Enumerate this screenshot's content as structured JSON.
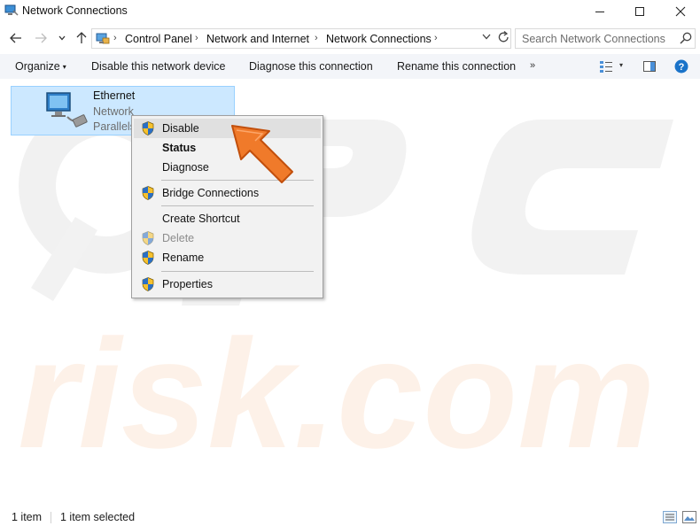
{
  "window": {
    "title": "Network Connections",
    "minimize_icon": "minimize-icon",
    "maximize_icon": "maximize-icon",
    "close_icon": "close-icon"
  },
  "address": {
    "breadcrumbs": [
      "Control Panel",
      "Network and Internet",
      "Network Connections"
    ],
    "search_placeholder": "Search Network Connections"
  },
  "commands": {
    "organize": "Organize",
    "disable": "Disable this network device",
    "diagnose": "Diagnose this connection",
    "rename": "Rename this connection",
    "more": "»"
  },
  "item": {
    "name": "Ethernet",
    "status": "Network",
    "device": "Parallels"
  },
  "context_menu": {
    "items": [
      {
        "label": "Disable",
        "shield": true,
        "bold": false,
        "disabled": false,
        "highlighted": true
      },
      {
        "label": "Status",
        "shield": false,
        "bold": true,
        "disabled": false,
        "highlighted": false
      },
      {
        "label": "Diagnose",
        "shield": false,
        "bold": false,
        "disabled": false,
        "highlighted": false
      },
      {
        "label": "Bridge Connections",
        "shield": true,
        "bold": false,
        "disabled": false,
        "highlighted": false
      },
      {
        "label": "Create Shortcut",
        "shield": false,
        "bold": false,
        "disabled": false,
        "highlighted": false
      },
      {
        "label": "Delete",
        "shield": true,
        "bold": false,
        "disabled": true,
        "highlighted": false
      },
      {
        "label": "Rename",
        "shield": true,
        "bold": false,
        "disabled": false,
        "highlighted": false
      },
      {
        "label": "Properties",
        "shield": true,
        "bold": false,
        "disabled": false,
        "highlighted": false
      }
    ]
  },
  "status": {
    "count": "1 item",
    "selected": "1 item selected"
  },
  "colors": {
    "selection_bg": "#cce8ff",
    "selection_border": "#99d1ff",
    "arrow": "#f07a2a",
    "help": "#1a73c9"
  }
}
